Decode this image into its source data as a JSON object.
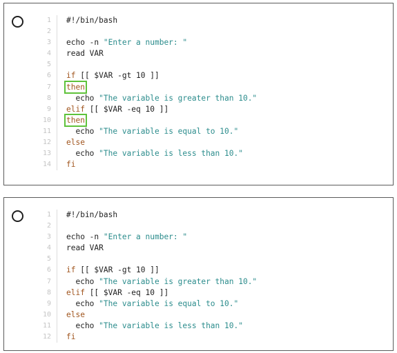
{
  "options": [
    {
      "id": "a",
      "lines": [
        {
          "n": "1",
          "tokens": [
            {
              "t": "#!/bin/bash",
              "c": "plain"
            }
          ]
        },
        {
          "n": "2",
          "tokens": []
        },
        {
          "n": "3",
          "tokens": [
            {
              "t": "echo -n ",
              "c": "plain"
            },
            {
              "t": "\"Enter a number: \"",
              "c": "str"
            }
          ]
        },
        {
          "n": "4",
          "tokens": [
            {
              "t": "read VAR",
              "c": "plain"
            }
          ]
        },
        {
          "n": "5",
          "tokens": []
        },
        {
          "n": "6",
          "tokens": [
            {
              "t": "if",
              "c": "kw"
            },
            {
              "t": " [[ $VAR -gt 10 ]]",
              "c": "plain"
            }
          ]
        },
        {
          "n": "7",
          "tokens": [
            {
              "t": "then",
              "c": "kw",
              "hl": true
            }
          ]
        },
        {
          "n": "8",
          "tokens": [
            {
              "t": "  echo ",
              "c": "plain"
            },
            {
              "t": "\"The variable is greater than 10.\"",
              "c": "str"
            }
          ]
        },
        {
          "n": "9",
          "tokens": [
            {
              "t": "elif",
              "c": "kw"
            },
            {
              "t": " [[ $VAR -eq 10 ]]",
              "c": "plain"
            }
          ]
        },
        {
          "n": "10",
          "tokens": [
            {
              "t": "then",
              "c": "kw",
              "hl": true
            }
          ]
        },
        {
          "n": "11",
          "tokens": [
            {
              "t": "  echo ",
              "c": "plain"
            },
            {
              "t": "\"The variable is equal to 10.\"",
              "c": "str"
            }
          ]
        },
        {
          "n": "12",
          "tokens": [
            {
              "t": "else",
              "c": "kw"
            }
          ]
        },
        {
          "n": "13",
          "tokens": [
            {
              "t": "  echo ",
              "c": "plain"
            },
            {
              "t": "\"The variable is less than 10.\"",
              "c": "str"
            }
          ]
        },
        {
          "n": "14",
          "tokens": [
            {
              "t": "fi",
              "c": "kw"
            }
          ]
        }
      ]
    },
    {
      "id": "b",
      "lines": [
        {
          "n": "1",
          "tokens": [
            {
              "t": "#!/bin/bash",
              "c": "plain"
            }
          ]
        },
        {
          "n": "2",
          "tokens": []
        },
        {
          "n": "3",
          "tokens": [
            {
              "t": "echo -n ",
              "c": "plain"
            },
            {
              "t": "\"Enter a number: \"",
              "c": "str"
            }
          ]
        },
        {
          "n": "4",
          "tokens": [
            {
              "t": "read VAR",
              "c": "plain"
            }
          ]
        },
        {
          "n": "5",
          "tokens": []
        },
        {
          "n": "6",
          "tokens": [
            {
              "t": "if",
              "c": "kw"
            },
            {
              "t": " [[ $VAR -gt 10 ]]",
              "c": "plain"
            }
          ]
        },
        {
          "n": "7",
          "tokens": [
            {
              "t": "  echo ",
              "c": "plain"
            },
            {
              "t": "\"The variable is greater than 10.\"",
              "c": "str"
            }
          ]
        },
        {
          "n": "8",
          "tokens": [
            {
              "t": "elif",
              "c": "kw"
            },
            {
              "t": " [[ $VAR -eq 10 ]]",
              "c": "plain"
            }
          ]
        },
        {
          "n": "9",
          "tokens": [
            {
              "t": "  echo ",
              "c": "plain"
            },
            {
              "t": "\"The variable is equal to 10.\"",
              "c": "str"
            }
          ]
        },
        {
          "n": "10",
          "tokens": [
            {
              "t": "else",
              "c": "kw"
            }
          ]
        },
        {
          "n": "11",
          "tokens": [
            {
              "t": "  echo ",
              "c": "plain"
            },
            {
              "t": "\"The variable is less than 10.\"",
              "c": "str"
            }
          ]
        },
        {
          "n": "12",
          "tokens": [
            {
              "t": "fi",
              "c": "kw"
            }
          ]
        }
      ]
    }
  ],
  "colors": {
    "keyword": "#a0551e",
    "string": "#2b8c8c",
    "highlight_box": "#5ec23a",
    "line_number": "#c4c4c4"
  },
  "icons": {
    "radio": "radio-button-unselected-icon"
  }
}
